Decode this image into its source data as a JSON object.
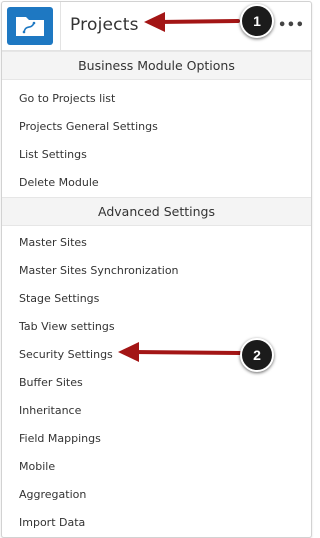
{
  "header": {
    "title": "Projects",
    "more_label": "•••",
    "app_icon": "folder-link-icon",
    "accent": "#1e78c2"
  },
  "sections": [
    {
      "title": "Business Module Options",
      "items": [
        "Go to Projects list",
        "Projects General Settings",
        "List Settings",
        "Delete Module"
      ]
    },
    {
      "title": "Advanced Settings",
      "items": [
        "Master Sites",
        "Master Sites Synchronization",
        "Stage Settings",
        "Tab View settings",
        "Security Settings",
        "Buffer Sites",
        "Inheritance",
        "Field Mappings",
        "Mobile",
        "Aggregation",
        "Import Data"
      ]
    }
  ],
  "annotations": [
    {
      "number": "1",
      "arrow_color": "#a31515"
    },
    {
      "number": "2",
      "arrow_color": "#a31515"
    }
  ]
}
